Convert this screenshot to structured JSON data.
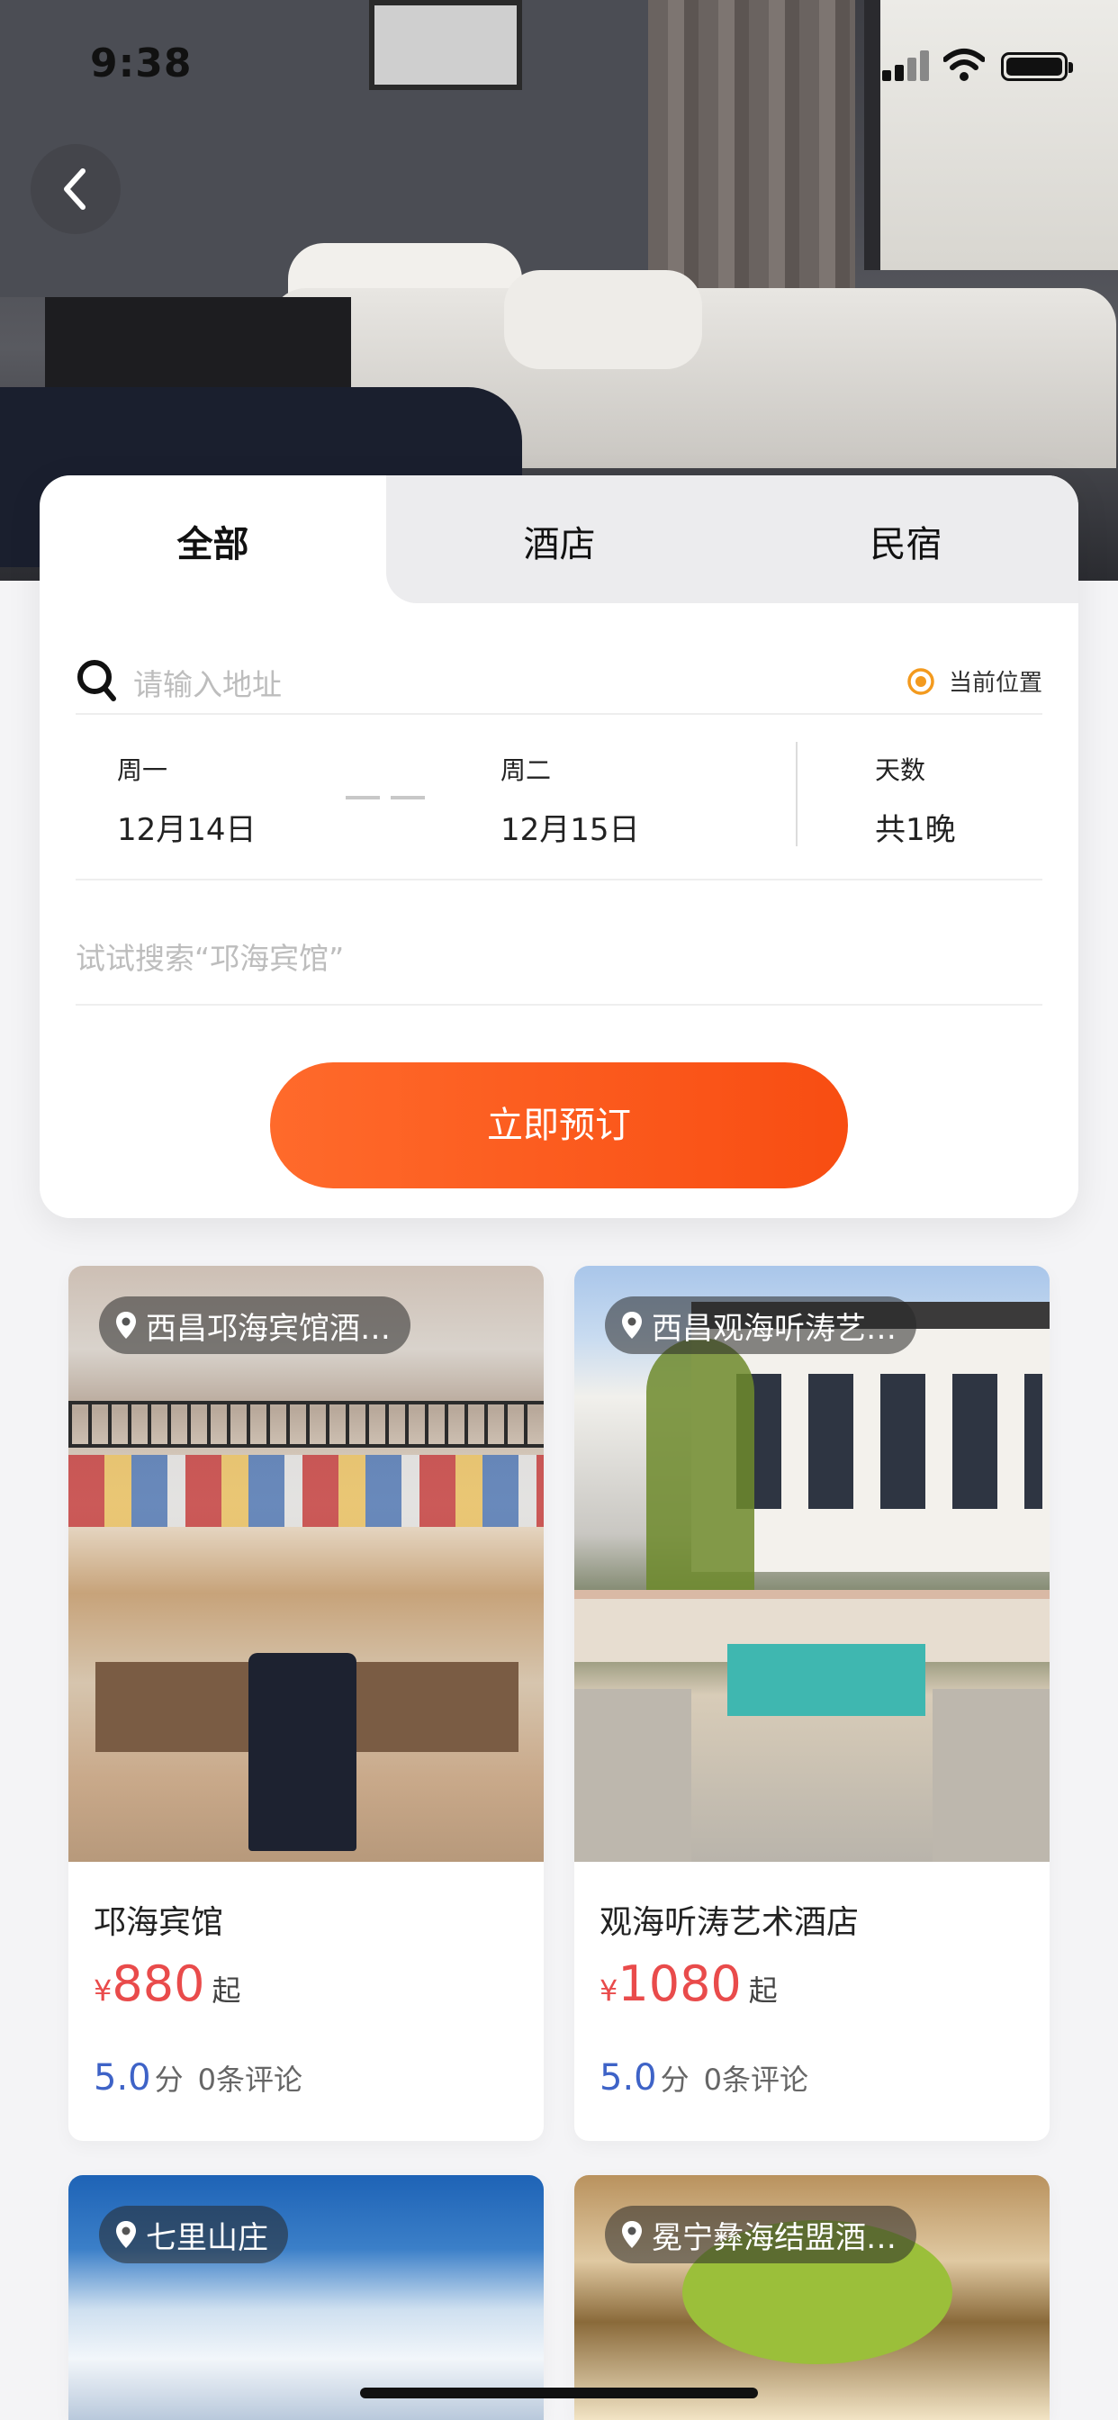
{
  "status_bar": {
    "time": "9:38"
  },
  "tabs": [
    {
      "label": "全部",
      "active": true
    },
    {
      "label": "酒店",
      "active": false
    },
    {
      "label": "民宿",
      "active": false
    }
  ],
  "search": {
    "placeholder": "请输入地址",
    "location_label": "当前位置"
  },
  "dates": {
    "checkin": {
      "weekday": "周一",
      "date": "12月14日"
    },
    "checkout": {
      "weekday": "周二",
      "date": "12月15日"
    },
    "nights": {
      "label": "天数",
      "value": "共1晚"
    }
  },
  "hint": "试试搜索“邛海宾馆”",
  "book_button": "立即预订",
  "listings": [
    {
      "location_tag": "西昌邛海宾馆酒…",
      "name": "邛海宾馆",
      "currency": "¥",
      "price": "880",
      "price_suffix": "起",
      "score": "5.0",
      "score_unit": "分",
      "reviews": "0条评论"
    },
    {
      "location_tag": "西昌观海听涛艺…",
      "name": "观海听涛艺术酒店",
      "currency": "¥",
      "price": "1080",
      "price_suffix": "起",
      "score": "5.0",
      "score_unit": "分",
      "reviews": "0条评论"
    },
    {
      "location_tag": "七里山庄"
    },
    {
      "location_tag": "冕宁彝海结盟酒…"
    }
  ],
  "colors": {
    "accent": "#f8581c",
    "price": "#e94b4b",
    "score": "#3e63c7"
  }
}
